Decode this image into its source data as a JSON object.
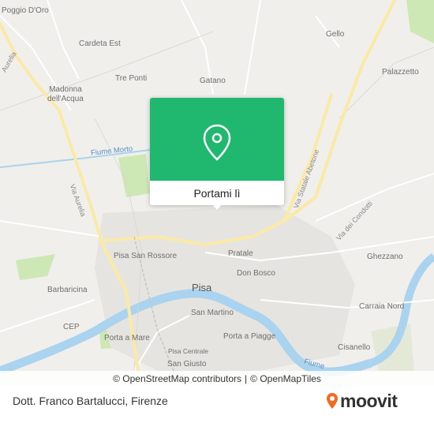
{
  "map": {
    "labels": {
      "poggio": "Poggio D'Oro",
      "cardeta": "Cardeta Est",
      "gello": "Gello",
      "aurelia_top": "Aurelia",
      "palazzetto": "Palazzetto",
      "tre_ponti": "Tre Ponti",
      "gatano": "Gatano",
      "madonna": "Madonna\ndell'Acqua",
      "fiume_morto": "Fiume Morto",
      "via_aurelia": "Via Aurelia",
      "statale": "Via Statale Abetone",
      "condotti": "Via dei Condotti",
      "pisa_sr": "Pisa San Rossore",
      "pratale": "Pratale",
      "ghezzano": "Ghezzano",
      "don_bosco": "Don Bosco",
      "pisa": "Pisa",
      "barbaricina": "Barbaricina",
      "carraia": "Carraia Nord",
      "san_martino": "San Martino",
      "cep": "CEP",
      "porta_mare": "Porta a Mare",
      "porta_piagge": "Porta a Piagge",
      "cisanello": "Cisanello",
      "pisa_centrale": "Pisa Centrale",
      "san_giusto": "San Giusto",
      "fiume": "Fiume"
    },
    "colors": {
      "land": "#f0efec",
      "water": "#a9d3ee",
      "park": "#cde8b5",
      "road_major": "#fbe9a6",
      "pin_header": "#1fb86e"
    }
  },
  "popup": {
    "button_label": "Portami lì",
    "icon": "location-pin-icon"
  },
  "attribution": {
    "osm": "© OpenStreetMap contributors",
    "sep": "|",
    "omt": "© OpenMapTiles"
  },
  "footer": {
    "place": "Dott. Franco Bartalucci, Firenze",
    "brand": "moovit"
  }
}
